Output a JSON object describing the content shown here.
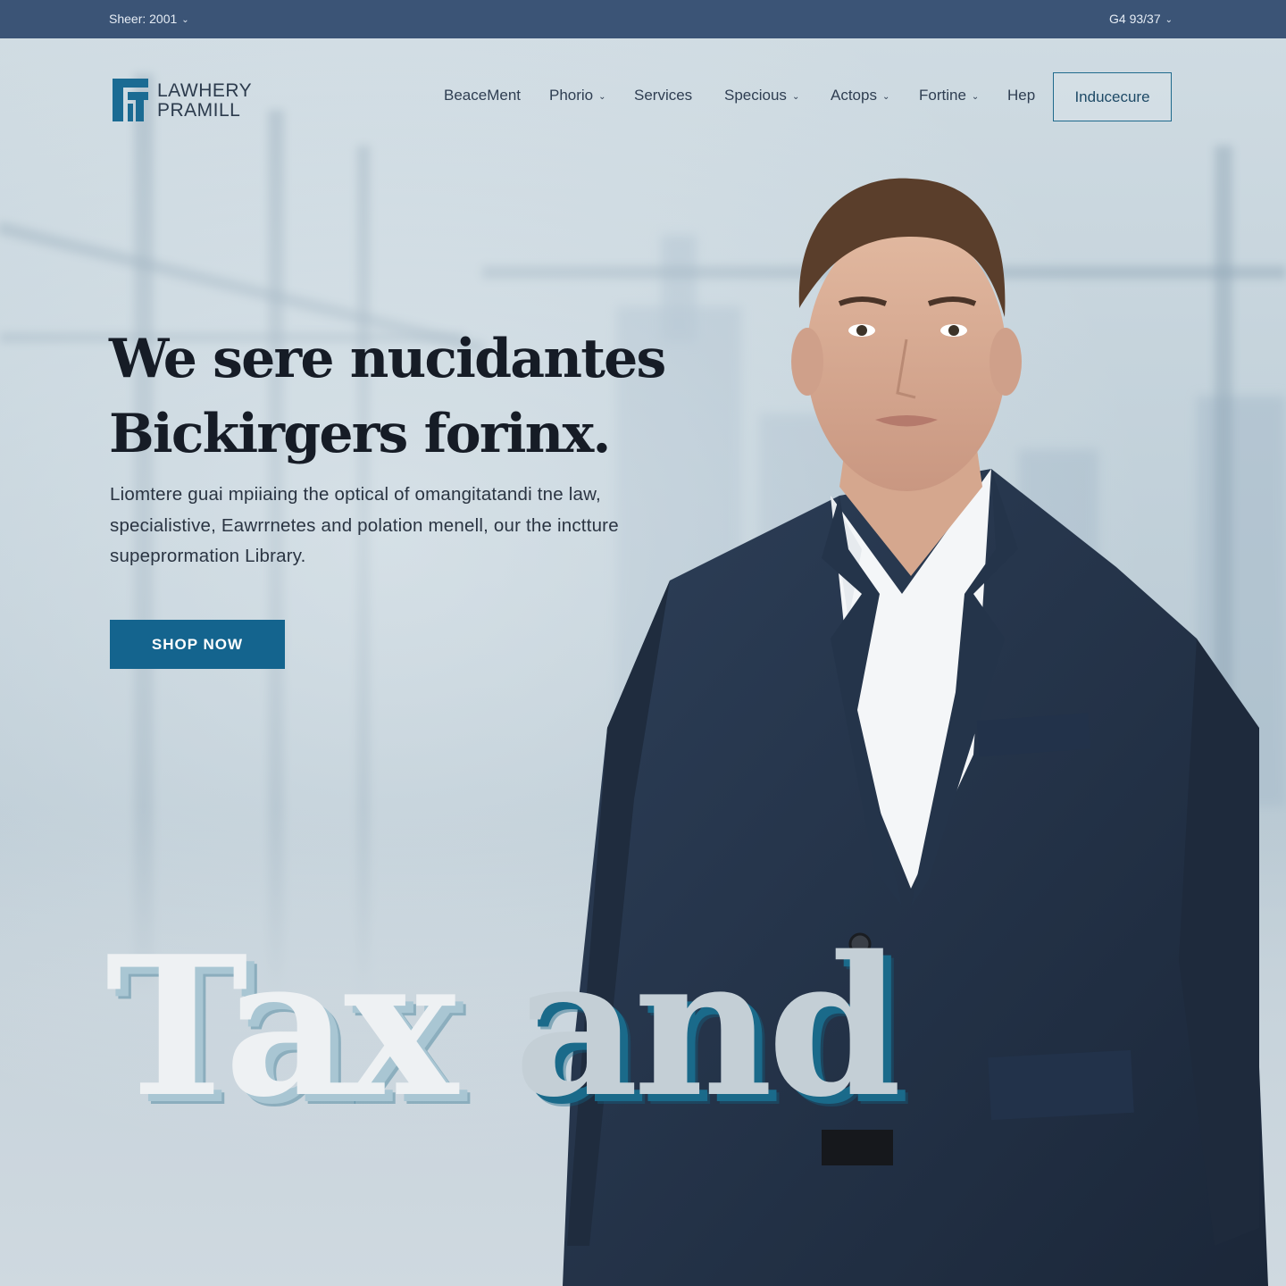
{
  "topbar": {
    "left_label": "Sheer: 2001",
    "right_label": "G4 93/37"
  },
  "logo": {
    "line1": "LAWHERY",
    "line2": "PRAMILL"
  },
  "nav": {
    "items": [
      {
        "label": "BeaceMent",
        "dropdown": false
      },
      {
        "label": "Phorio",
        "dropdown": true
      },
      {
        "label": "Services",
        "dropdown": false
      },
      {
        "label": "Specious",
        "dropdown": true
      },
      {
        "label": "Actops",
        "dropdown": true
      },
      {
        "label": "Fortine",
        "dropdown": true
      },
      {
        "label": "Hep",
        "dropdown": false
      }
    ],
    "cta_label": "Inducecure"
  },
  "hero": {
    "headline_line1": "We sere nucidantes",
    "headline_line2": "Bickirgers forinx.",
    "subtext_line1": "Liomtere guai mpiiaing the optical of omangitatandi tne law,",
    "subtext_line2": "specialistive, Eawrrnetes and polation menell, our the inctture",
    "subtext_line3": "supeprormation Library.",
    "button_label": "SHOP NOW"
  },
  "giant_text": {
    "word1": "Tax",
    "word2": "and"
  },
  "icons": {
    "dropdown": "chevron-down-icon",
    "logo": "logo-mark-icon"
  },
  "colors": {
    "topbar_bg": "#3b5476",
    "brand_blue": "#14648e",
    "headline": "#161c26"
  }
}
